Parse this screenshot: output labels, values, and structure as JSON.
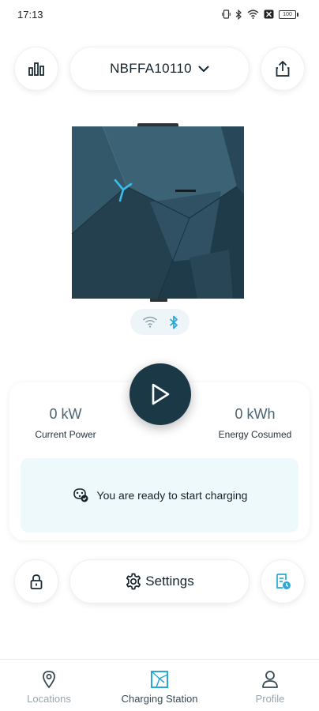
{
  "status_bar": {
    "time": "17:13",
    "battery": "100"
  },
  "header": {
    "device_name": "NBFFA10110"
  },
  "metrics": {
    "power_value": "0 kW",
    "power_label": "Current Power",
    "energy_value": "0 kWh",
    "energy_label": "Energy Cosumed"
  },
  "status_message": "You are ready to start charging",
  "actions": {
    "settings_label": "Settings"
  },
  "nav": {
    "items": [
      {
        "label": "Locations",
        "icon": "location-pin-icon",
        "active": false
      },
      {
        "label": "Charging Station",
        "icon": "charging-station-icon",
        "active": true
      },
      {
        "label": "Profile",
        "icon": "person-icon",
        "active": false
      }
    ]
  },
  "colors": {
    "accent": "#2aa8d8",
    "dark_teal": "#1b3846",
    "status_box": "#eef9fc",
    "inactive_nav": "#9aa6ad"
  }
}
